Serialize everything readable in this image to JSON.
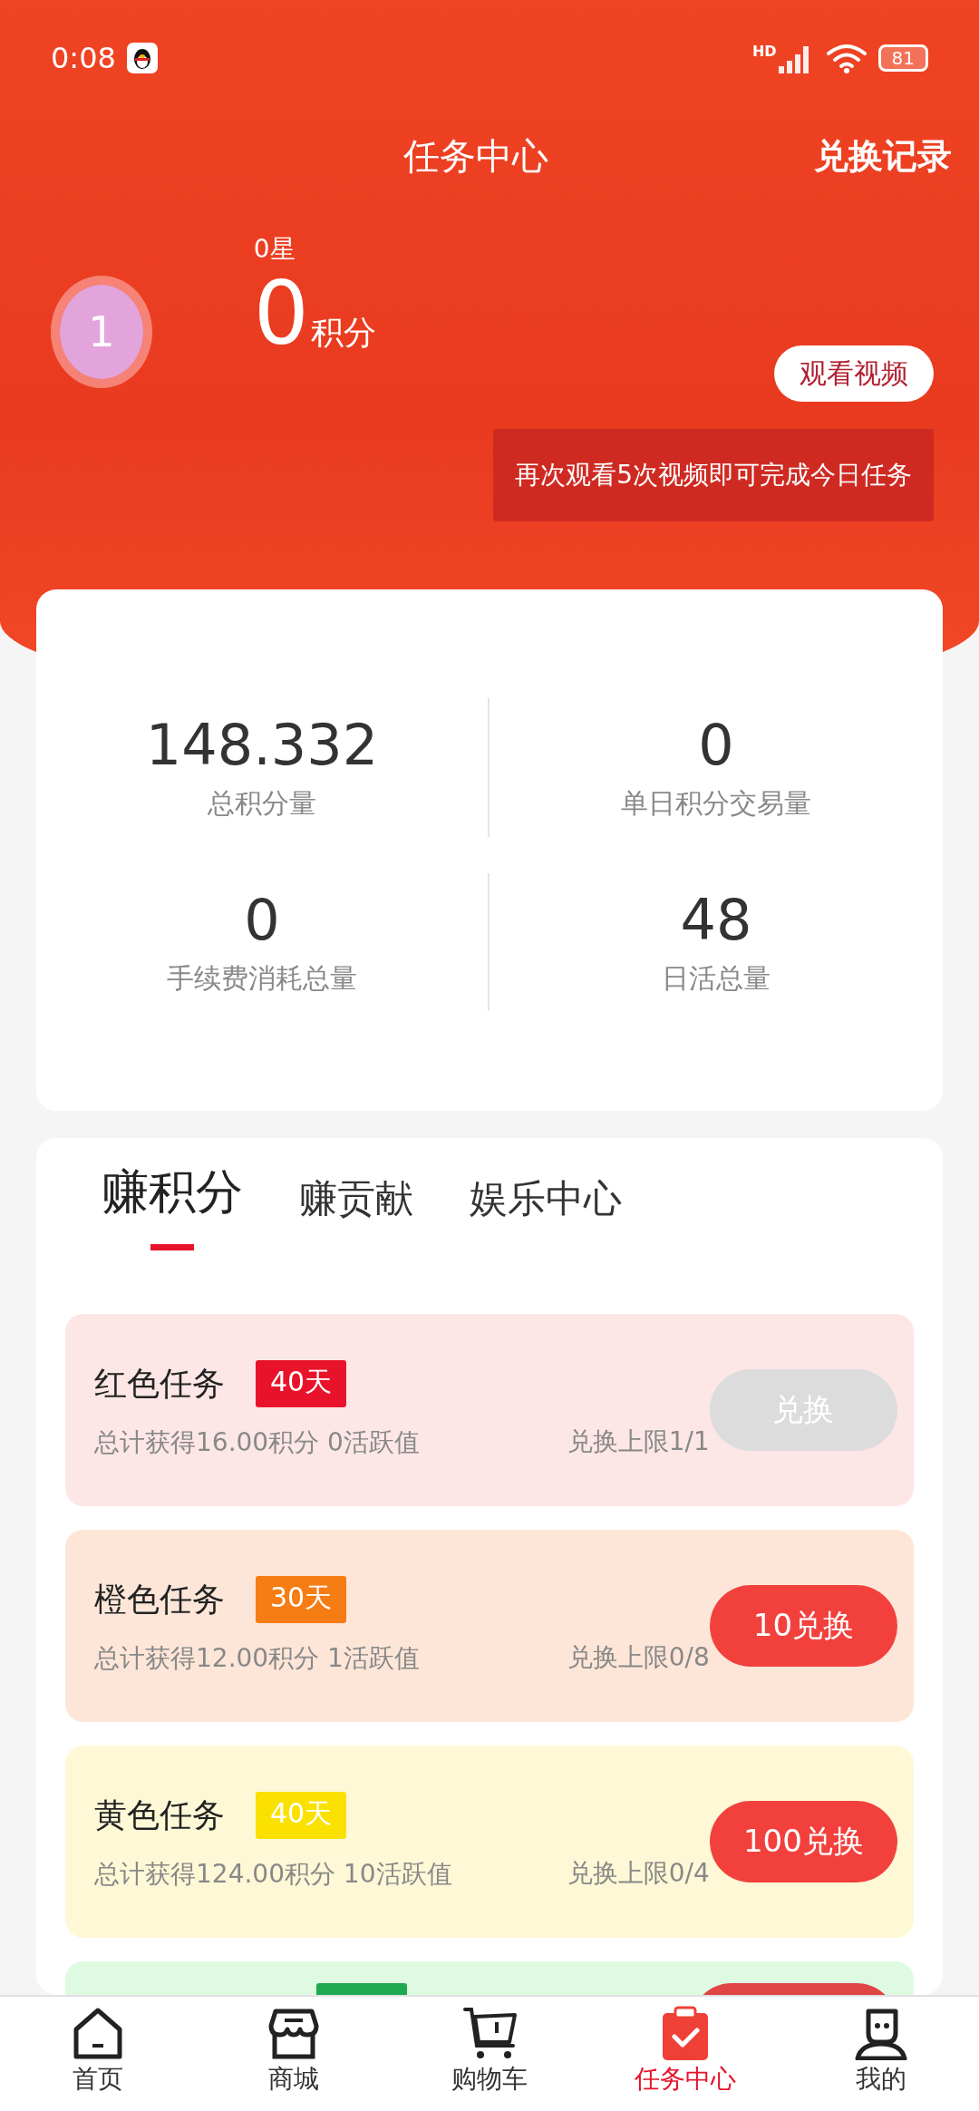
{
  "status_bar": {
    "time": "0:08",
    "network": "HD",
    "battery": "81"
  },
  "header": {
    "title": "任务中心",
    "action": "兑换记录"
  },
  "profile": {
    "avatar": "1",
    "stars": "0星",
    "points": "0",
    "points_unit": "积分",
    "watch_button": "观看视频",
    "tooltip": "再次观看5次视频即可完成今日任务"
  },
  "stats": [
    {
      "value": "148.332",
      "label": "总积分量"
    },
    {
      "value": "0",
      "label": "单日积分交易量"
    },
    {
      "value": "0",
      "label": "手续费消耗总量"
    },
    {
      "value": "48",
      "label": "日活总量"
    }
  ],
  "tabs": [
    {
      "label": "赚积分",
      "selected": true
    },
    {
      "label": "赚贡献",
      "selected": false
    },
    {
      "label": "娱乐中心",
      "selected": false
    }
  ],
  "tasks": [
    {
      "title": "红色任务",
      "badge": {
        "text": "40天",
        "color": "#e8132b"
      },
      "color": "#fde6e6",
      "summary": "总计获得16.00积分 0活跃值",
      "limit": "兑换上限1/1",
      "button": "兑换",
      "disabled": true
    },
    {
      "title": "橙色任务",
      "badge": {
        "text": "30天",
        "color": "#f67d13"
      },
      "color": "#fde6d8",
      "summary": "总计获得12.00积分 1活跃值",
      "limit": "兑换上限0/8",
      "button": "10兑换",
      "disabled": false
    },
    {
      "title": "黄色任务",
      "badge": {
        "text": "40天",
        "color": "#fae100"
      },
      "color": "#fef8d6",
      "summary": "总计获得124.00积分 10活跃值",
      "limit": "兑换上限0/4",
      "button": "100兑换",
      "disabled": false
    },
    {
      "color": "#defbe2",
      "badge": {
        "color": "#1fa852"
      }
    }
  ],
  "nav": [
    {
      "label": "首页",
      "selected": false
    },
    {
      "label": "商城",
      "selected": false
    },
    {
      "label": "购物车",
      "selected": false
    },
    {
      "label": "任务中心",
      "selected": true
    },
    {
      "label": "我的",
      "selected": false
    }
  ]
}
